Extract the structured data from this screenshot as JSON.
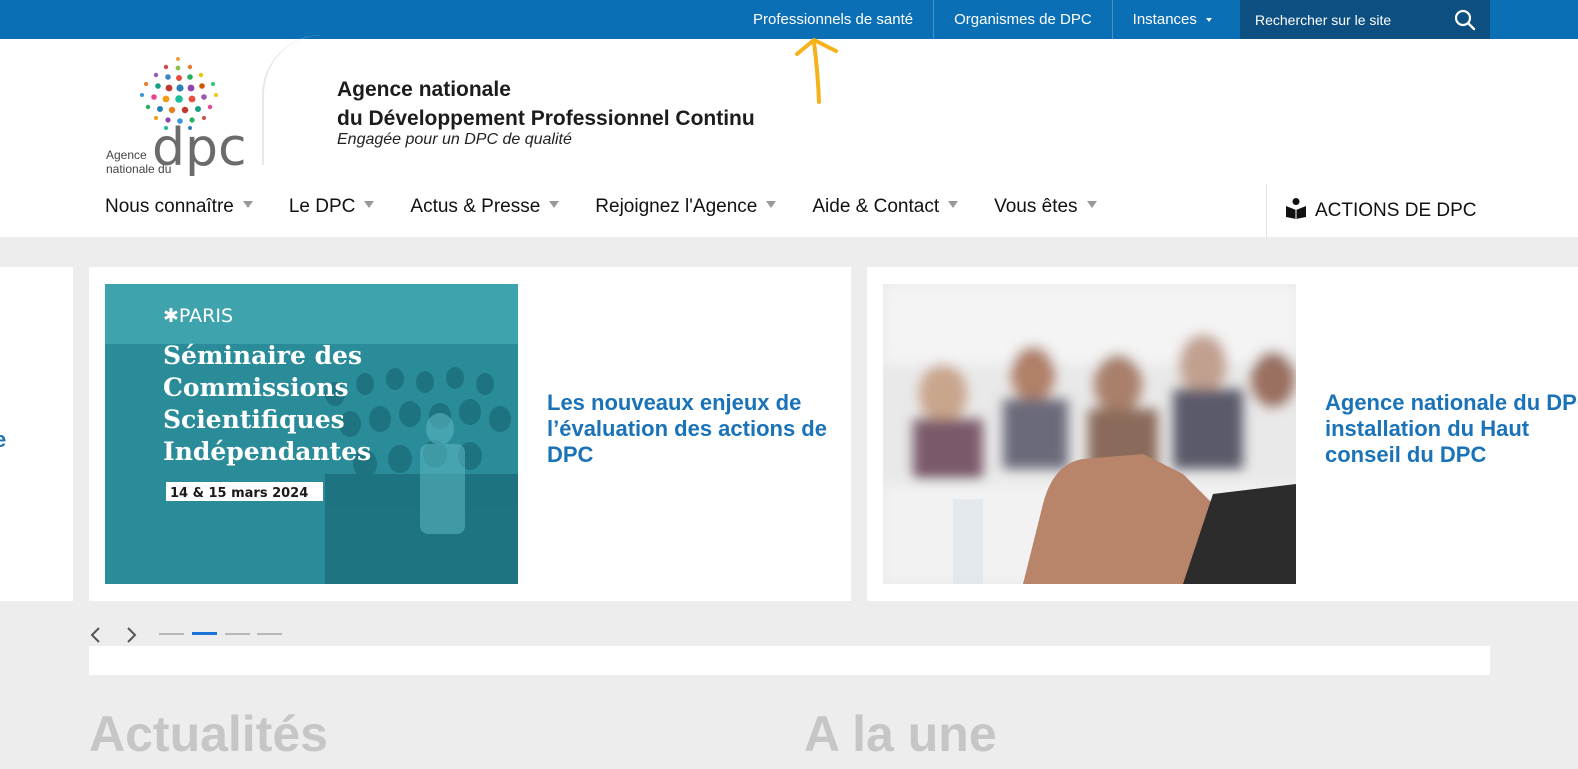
{
  "topbar": {
    "links": [
      {
        "label": "Professionnels de santé"
      },
      {
        "label": "Organismes de DPC"
      },
      {
        "label": "Instances"
      }
    ],
    "search_placeholder": "Rechercher sur le site"
  },
  "header": {
    "logo": {
      "line1": "Agence",
      "line2": "nationale du",
      "mark": "dpc"
    },
    "title_line1": "Agence nationale",
    "title_line2": "du Développement Professionnel Continu",
    "tagline": "Engagée pour un DPC de qualité"
  },
  "nav": {
    "items": [
      "Nous connaître",
      "Le DPC",
      "Actus & Presse",
      "Rejoignez l'Agence",
      "Aide & Contact",
      "Vous êtes"
    ],
    "actions_label": "ACTIONS DE DPC"
  },
  "carousel": {
    "partial_left_fragment": "e",
    "slides": [
      {
        "image_text": {
          "city": "PARIS",
          "headline": [
            "Séminaire des",
            "Commissions",
            "Scientifiques",
            "Indépendantes"
          ],
          "date": "14 & 15 mars 2024"
        },
        "title": "Les nouveaux enjeux de l’évaluation des actions de DPC"
      },
      {
        "title_lines": [
          "Agence nationale du DPC :",
          "installation du Haut",
          "conseil du DPC"
        ]
      }
    ],
    "dots": 4,
    "active_dot": 1
  },
  "sections": {
    "left": "Actualités",
    "right": "A la une"
  },
  "colors": {
    "topbar": "#0a6fb5",
    "search": "#0c4f80",
    "link_blue": "#1a73b8",
    "annotation": "#f5b21a"
  }
}
